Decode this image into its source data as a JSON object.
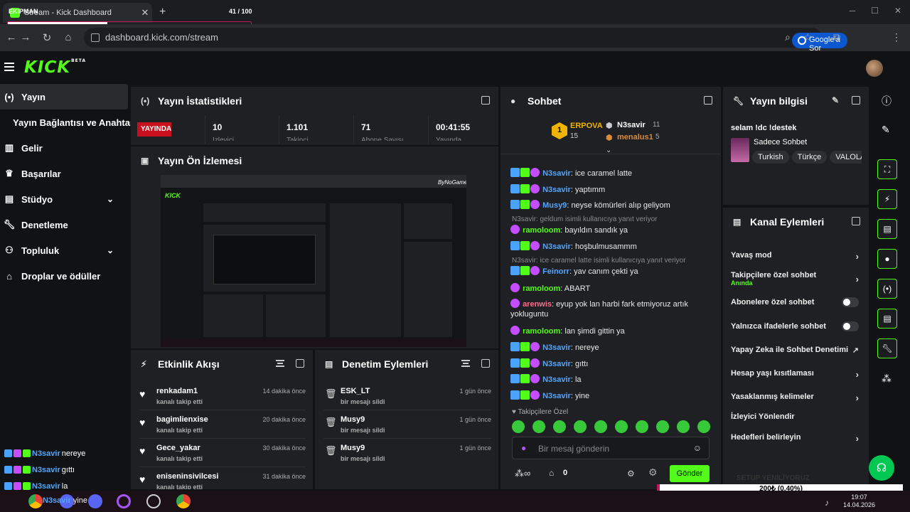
{
  "browser": {
    "tab_title": "Stream - Kick Dashboard",
    "tab_prefix": "EKIPMAN",
    "counter": "41 / 100",
    "counter_progress": 0.41,
    "url": "dashboard.kick.com/stream",
    "google_btn": "Google'a Sor"
  },
  "kick": {
    "logo": "KICK",
    "beta": "BETA"
  },
  "sidebar": {
    "items": [
      {
        "label": "Yayın",
        "icon": "broadcast-icon"
      },
      {
        "label": "Yayın Bağlantısı ve Anahtarı",
        "icon": ""
      },
      {
        "label": "Gelir",
        "icon": "chart-icon"
      },
      {
        "label": "Başarılar",
        "icon": "trophy-icon"
      },
      {
        "label": "Stüdyo",
        "icon": "studio-icon"
      },
      {
        "label": "Denetleme",
        "icon": "wrench-icon"
      },
      {
        "label": "Topluluk",
        "icon": "people-icon"
      },
      {
        "label": "Droplar ve ödüller",
        "icon": "gift-icon"
      }
    ],
    "chat_overlay": [
      {
        "user": "N3savir",
        "text": "nereye"
      },
      {
        "user": "N3savir",
        "text": "gıttı"
      },
      {
        "user": "N3savir",
        "text": "la"
      },
      {
        "user": "N3savir",
        "text": "yine"
      }
    ]
  },
  "stats": {
    "title": "Yayın İstatistikleri",
    "live": "YAYINDA",
    "items": [
      {
        "value": "10",
        "label": "İzleyici"
      },
      {
        "value": "1.101",
        "label": "Takipçi"
      },
      {
        "value": "71",
        "label": "Abone Sayısı"
      },
      {
        "value": "00:41:55",
        "label": "Yayında"
      }
    ]
  },
  "preview": {
    "title": "Yayın Ön İzlemesi",
    "watermark": "ByNoGame"
  },
  "events": {
    "title": "Etkinlik Akışı",
    "rows": [
      {
        "name": "renkadam1",
        "sub": "kanalı takip etti",
        "time": "14 dakika önce"
      },
      {
        "name": "bagimlienxise",
        "sub": "kanalı takip etti",
        "time": "20 dakika önce"
      },
      {
        "name": "Gece_yakar",
        "sub": "kanalı takip etti",
        "time": "30 dakika önce"
      },
      {
        "name": "eniseninsivilcesi",
        "sub": "kanalı takip etti",
        "time": "31 dakika önce"
      }
    ]
  },
  "moderation": {
    "title": "Denetim Eylemleri",
    "rows": [
      {
        "name": "ESK_LT",
        "sub": "bir mesajı sildi",
        "time": "1 gün önce"
      },
      {
        "name": "Musy9",
        "sub": "bir mesajı sildi",
        "time": "1 gün önce"
      },
      {
        "name": "Musy9",
        "sub": "bir mesajı sildi",
        "time": "1 gün önce"
      }
    ]
  },
  "chat": {
    "title": "Sohbet",
    "top_gifters": {
      "first": {
        "name": "ERPOVA",
        "count": "15"
      },
      "second": {
        "name": "N3savir",
        "count": "11"
      },
      "third": {
        "name": "menalus1",
        "count": "5"
      }
    },
    "messages": [
      {
        "user": "N3savir",
        "text": "ice caramel latte",
        "color": "#53a6fc"
      },
      {
        "user": "N3savir",
        "text": "yaptımm",
        "color": "#53a6fc"
      },
      {
        "user": "Musy9",
        "text": "neyse kömürleri alıp geliyom",
        "color": "#53a6fc"
      },
      {
        "user": "ramoloom",
        "text": "bayıldın sandık ya",
        "color": "#53fc18",
        "reply": "N3savir: geldum isimli kullanıcıya yanıt veriyor"
      },
      {
        "user": "N3savir",
        "text": "hoşbulmusammm",
        "color": "#53a6fc"
      },
      {
        "user": "Feinorr",
        "text": "yav canım çekti ya",
        "color": "#53a6fc",
        "reply": "N3savir: ice caramel latte isimli kullanıcıya yanıt veriyor"
      },
      {
        "user": "ramoloom",
        "text": "ABART",
        "color": "#53fc18"
      },
      {
        "user": "arenwis",
        "text": "eyup yok lan harbi fark etmiyoruz artık yokluguntu",
        "color": "#ff6d8f"
      },
      {
        "user": "ramoloom",
        "text": "lan şimdi gittin ya",
        "color": "#53fc18"
      },
      {
        "user": "N3savir",
        "text": "nereye",
        "color": "#53a6fc"
      },
      {
        "user": "N3savir",
        "text": "gıttı",
        "color": "#53a6fc"
      },
      {
        "user": "N3savir",
        "text": "la",
        "color": "#53a6fc"
      },
      {
        "user": "N3savir",
        "text": "yine",
        "color": "#53a6fc"
      }
    ],
    "followers_only": "Takipçilere Özel",
    "placeholder": "Bir mesaj gönderin",
    "points": "0",
    "send": "Gönder"
  },
  "stream_info": {
    "title": "Yayın bilgisi",
    "stream_title": "selam !dc !destek",
    "category": "Sadece Sohbet",
    "tags": [
      "Turkish",
      "Türkçe",
      "VALOLA"
    ]
  },
  "channel_actions": {
    "title": "Kanal Eylemleri",
    "rows": [
      {
        "label": "Yavaş mod",
        "kind": "arrow"
      },
      {
        "label": "Takipçilere özel sohbet",
        "sub": "Anında",
        "kind": "arrow"
      },
      {
        "label": "Abonelere özel sohbet",
        "kind": "toggle"
      },
      {
        "label": "Yalnızca ifadelerle sohbet",
        "kind": "toggle"
      },
      {
        "label": "Yapay Zeka ile Sohbet Denetimi",
        "kind": "external"
      },
      {
        "label": "Hesap yaşı kısıtlaması",
        "kind": "arrow"
      },
      {
        "label": "Yasaklanmış kelimeler",
        "kind": "arrow"
      },
      {
        "label": "İzleyici Yönlendir",
        "kind": "none"
      },
      {
        "label": "Hedefleri belirleyin",
        "kind": "arrow"
      }
    ]
  },
  "overlay": {
    "setup_text": "SETUP YENİLİYORUZ",
    "donation": "200₺ (0.40%)",
    "donation_progress": 0.004
  },
  "taskbar": {
    "clock": "19:07",
    "date": "14.04.2026"
  },
  "colors": {
    "accent": "#53fc18",
    "panel": "#1f2023",
    "bg": "#111214",
    "live": "#c8101e"
  }
}
